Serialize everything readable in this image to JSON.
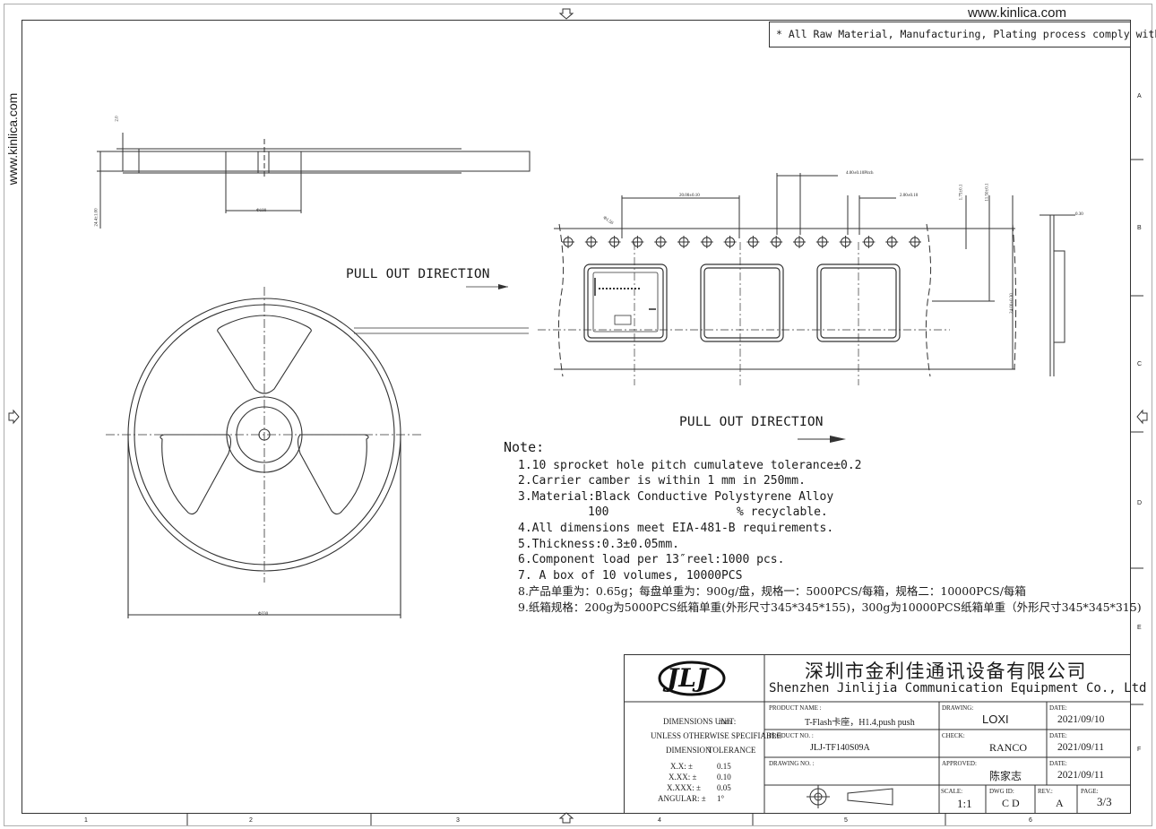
{
  "website": "www.kinlica.com",
  "rohs_note": "* All Raw Material, Manufacturing, Plating process comply with ROHS",
  "pull_out_direction": "PULL OUT DIRECTION",
  "notes": {
    "title": "Note:",
    "items": [
      "1.10 sprocket hole pitch cumulateve tolerance±0.2",
      "2.Carrier camber is within 1 mm in 250mm.",
      "3.Material:Black Conductive Polystyrene Alloy",
      "4.All dimensions meet EIA-481-B requirements.",
      "5.Thickness:0.3±0.05mm.",
      "6.Component load per 13″reel:1000 pcs.",
      " 7. A box of 10 volumes, 10000PCS",
      " 8.产品单重为：0.65g；每盘单重为：900g/盘，规格一：5000PCS/每箱，规格二：10000PCS/每箱",
      " 9.纸箱规格：200g为5000PCS纸箱单重(外形尺寸345*345*155)，300g为10000PCS纸箱单重（外形尺寸345*345*315)"
    ],
    "item3_sub_value": "100",
    "item3_sub_text": "% recyclable."
  },
  "title_block": {
    "company_cn": "深圳市金利佳通讯设备有限公司",
    "company_en": "Shenzhen Jinlijia Communication Equipment Co., Ltd .",
    "logo_text": "JLJ",
    "dimensions_unit_label": "DIMENSIONS UNIT:",
    "dimensions_unit_value": "mm",
    "unless_label": "UNLESS OTHERWISE SPECIFIABLE",
    "dimension_col": "DIMENSION",
    "tolerance_col": "TOLERANCE",
    "tolerances": [
      {
        "dim": "X.X: ±",
        "tol": "0.15"
      },
      {
        "dim": "X.XX: ±",
        "tol": "0.10"
      },
      {
        "dim": "X.XXX: ±",
        "tol": "0.05"
      },
      {
        "dim": "ANGULAR: ±",
        "tol": "1°"
      }
    ],
    "product_name_label": "PRODUCT NAME :",
    "product_name": "T-Flash卡座，H1.4,push push",
    "product_no_label": "PRODUCT NO. :",
    "product_no": "JLJ-TF140S09A",
    "drawing_no_label": "DRAWING NO. :",
    "drawing_label": "DRAWING:",
    "drawing_value": "LOXI",
    "check_label": "CHECK:",
    "check_value": "RANCO",
    "approved_label": "APPROVED:",
    "approved_value": "陈家志",
    "date_label": "DATE:",
    "dates": [
      "2021/09/10",
      "2021/09/11",
      "2021/09/11"
    ],
    "scale_label": "SCALE:",
    "scale_value": "1:1",
    "dwg_label": "DWG ID:",
    "dwg_value": "C D",
    "rev_label": "REV.:",
    "rev_value": "A",
    "page_label": "PAGE:",
    "page_value": "3/3"
  },
  "dimensions": {
    "pitch": "4.00±0.10Pitch",
    "spacing": "20.00±0.10",
    "pitch2": "2.00±0.10",
    "width": "24.00±0.30",
    "t1": "1.75±0.1",
    "t2": "11.50±0.1",
    "thick": "0.30",
    "reel_hub": "Φ330",
    "reel_core": "Φ100",
    "reel_w": "24.4",
    "reel_t": "2.0",
    "reel_total": "24.4±1.00",
    "hole": "Φ1.50"
  },
  "grid": {
    "bottom": [
      "1",
      "2",
      "3",
      "4",
      "5",
      "6"
    ],
    "right": [
      "A",
      "B",
      "C",
      "D",
      "E",
      "F"
    ]
  }
}
